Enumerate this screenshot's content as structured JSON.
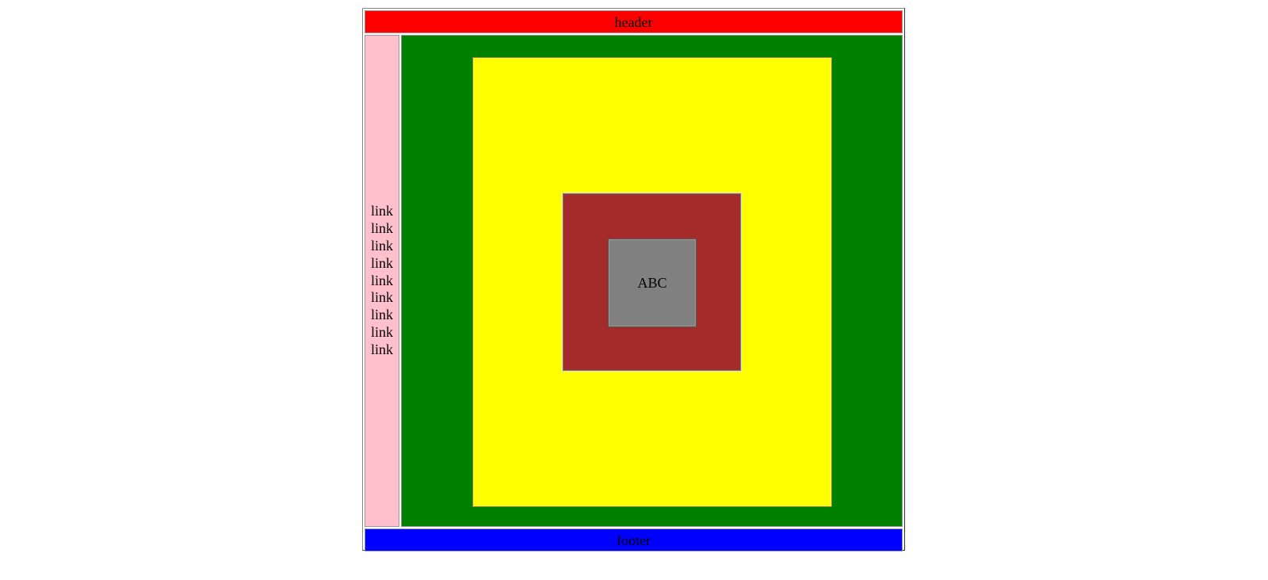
{
  "colors": {
    "header": "#ff0000",
    "sidebar": "#ffc0cb",
    "main": "#008000",
    "yellow_box": "#ffff00",
    "brown_box": "#a52a2a",
    "gray_box": "#808080",
    "footer": "#0000ff"
  },
  "header": {
    "text": "header"
  },
  "sidebar": {
    "links": [
      "link",
      "link",
      "link",
      "link",
      "link",
      "link",
      "link",
      "link",
      "link"
    ]
  },
  "main": {
    "center_text": "ABC"
  },
  "footer": {
    "text": "footer"
  }
}
